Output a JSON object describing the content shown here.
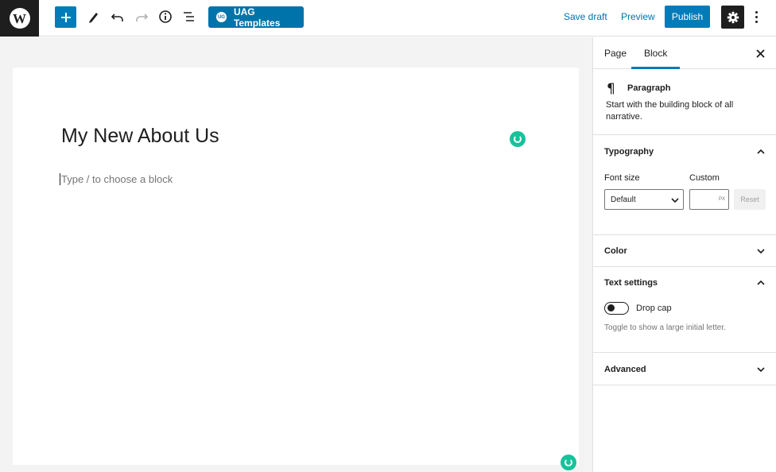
{
  "toolbar": {
    "add_block": "+",
    "uag_label": "UAG Templates",
    "uag_logo": "UG",
    "save_draft": "Save draft",
    "preview": "Preview",
    "publish": "Publish",
    "icons": [
      "wordpress-logo",
      "plus-icon",
      "pen-tool-icon",
      "undo-icon",
      "redo-icon",
      "info-icon",
      "list-view-icon",
      "gear-icon",
      "more-vertical-icon"
    ]
  },
  "editor": {
    "post_title": "My New About Us",
    "block_placeholder": "Type / to choose a block"
  },
  "sidebar": {
    "tabs": [
      "Page",
      "Block"
    ],
    "active_tab": "Block",
    "block_card": {
      "icon": "¶",
      "title": "Paragraph",
      "description": "Start with the building block of all narrative."
    },
    "typography": {
      "title": "Typography",
      "font_size_label": "Font size",
      "custom_label": "Custom",
      "font_size_value": "Default",
      "unit": "PX",
      "reset": "Reset"
    },
    "color": {
      "title": "Color"
    },
    "text_settings": {
      "title": "Text settings",
      "drop_cap_label": "Drop cap",
      "drop_cap_help": "Toggle to show a large initial letter."
    },
    "advanced": {
      "title": "Advanced"
    }
  },
  "colors": {
    "accent": "#007cba",
    "uag_button": "#0073aa",
    "grammarly": "#15c39a",
    "dark": "#1e1e1e"
  }
}
